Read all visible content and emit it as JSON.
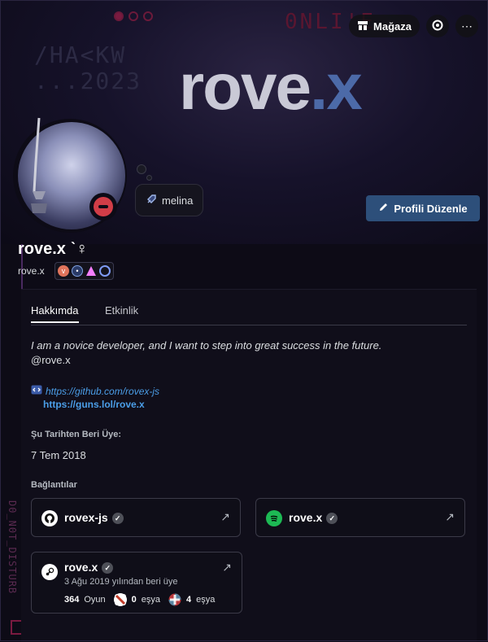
{
  "banner": {
    "left_text_1": "/HA<KW",
    "left_text_2": "...2023",
    "online_text": "0NLI'E",
    "big_name": "rove",
    "big_ext": ".x",
    "side_text": "D0_N0T_DISTURB"
  },
  "topbar": {
    "shop_label": "Mağaza",
    "more_label": "⋯"
  },
  "profile": {
    "display_name": "rove.x ˋ♀",
    "username": "rove.x",
    "status": "do-not-disturb",
    "custom_status": "melina",
    "edit_button": "Profili Düzenle",
    "status_color": "#d13d47"
  },
  "tabs": [
    {
      "label": "Hakkımda",
      "active": true
    },
    {
      "label": "Etkinlik",
      "active": false
    }
  ],
  "about": {
    "bio_line1": "I am a novice developer, and I want to step into great success in the future.",
    "bio_line2": "@rove.x",
    "link1": "https://github.com/rovex-js",
    "link2": "https://guns.lol/rove.x"
  },
  "member_since": {
    "label": "Şu Tarihten Beri Üye:",
    "value": "7 Tem 2018"
  },
  "connections": {
    "label": "Bağlantılar",
    "items": [
      {
        "service": "github",
        "name": "rovex-js"
      },
      {
        "service": "spotify",
        "name": "rove.x"
      }
    ],
    "steam": {
      "name": "rove.x",
      "member_since": "3 Ağu 2019 yılından beri üye",
      "games_count": "364",
      "games_label": "Oyun",
      "dota_count": "0",
      "dota_label": "eşya",
      "tf_count": "4",
      "tf_label": "eşya"
    }
  },
  "colors": {
    "accent_link": "#4b9ee8",
    "edit_button_bg": "#2d4f7a",
    "spotify_green": "#1db954"
  }
}
